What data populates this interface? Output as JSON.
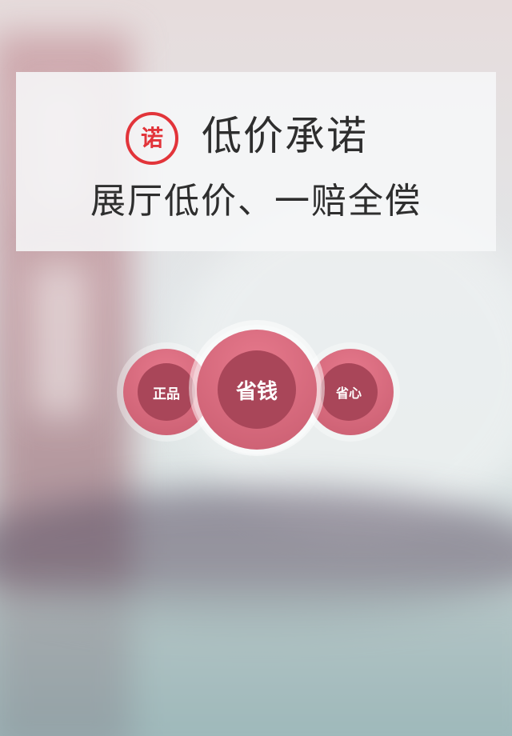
{
  "promise": {
    "seal_char": "诺",
    "title": "低价承诺",
    "subtitle": "展厅低价、一赔全偿",
    "seal_color": "#e2343a"
  },
  "bubbles": {
    "left_label": "正品",
    "center_label": "省钱",
    "right_label": "省心",
    "accent": "#c95d70"
  }
}
